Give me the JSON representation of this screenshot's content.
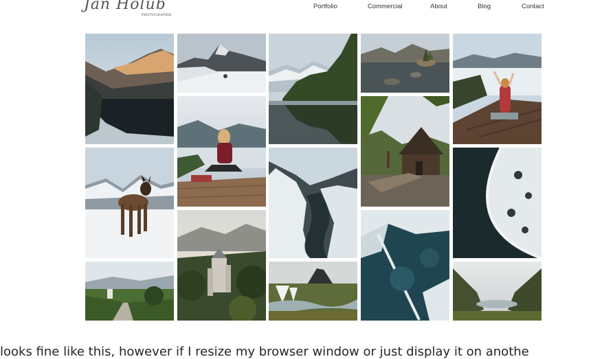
{
  "logo": {
    "script_text": "Jan Holub",
    "subtitle": "PHOTOGRAPHIE"
  },
  "nav": {
    "items": [
      "Portfolio",
      "Commercial",
      "About",
      "Blog",
      "Contact"
    ]
  },
  "gallery": {
    "photos": [
      {
        "subject": "mountain lake at sunset"
      },
      {
        "subject": "snowy mountain peaks"
      },
      {
        "subject": "alpine lake with forest reflection"
      },
      {
        "subject": "lake with small island"
      },
      {
        "subject": "woman sitting on dock above clouds"
      },
      {
        "subject": "dog standing in snow"
      },
      {
        "subject": "woman sitting on wooden dock"
      },
      {
        "subject": "winding river in snowy valley"
      },
      {
        "subject": "wooden cabin by lake"
      },
      {
        "subject": "aerial view of snowy lakeshore"
      },
      {
        "subject": "green valley with castle"
      },
      {
        "subject": "castle above forest"
      },
      {
        "subject": "waterfalls and mountain"
      },
      {
        "subject": "aerial view of frozen lake"
      },
      {
        "subject": "misty valley lake"
      }
    ]
  },
  "caption": {
    "text": "looks fine like this, however if I resize my browser window or just display it on anothe"
  }
}
